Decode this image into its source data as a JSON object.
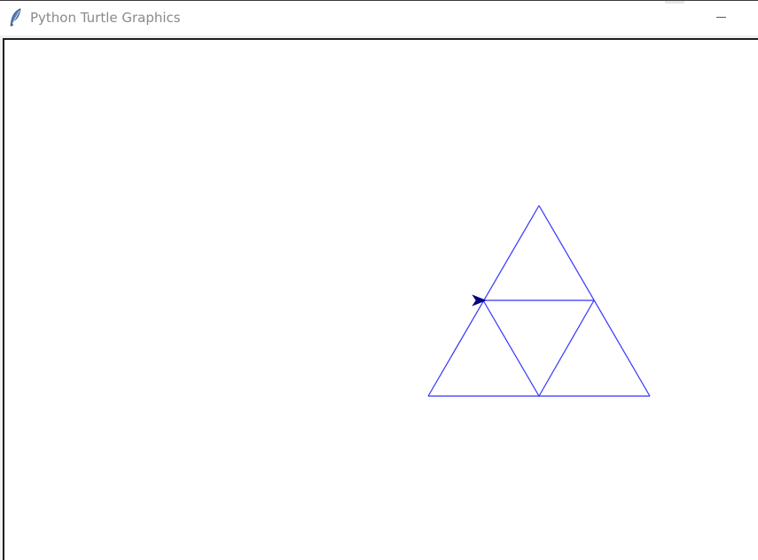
{
  "window": {
    "title": "Python Turtle Graphics",
    "icon": "feather-icon"
  },
  "controls": {
    "minimize_icon": "minimize-icon"
  },
  "canvas": {
    "background": "#ffffff",
    "pen_color": "#3333ff",
    "turtle_color": "#000080",
    "turtle_heading": "east",
    "turtle_icon": "turtle-arrow-icon"
  }
}
